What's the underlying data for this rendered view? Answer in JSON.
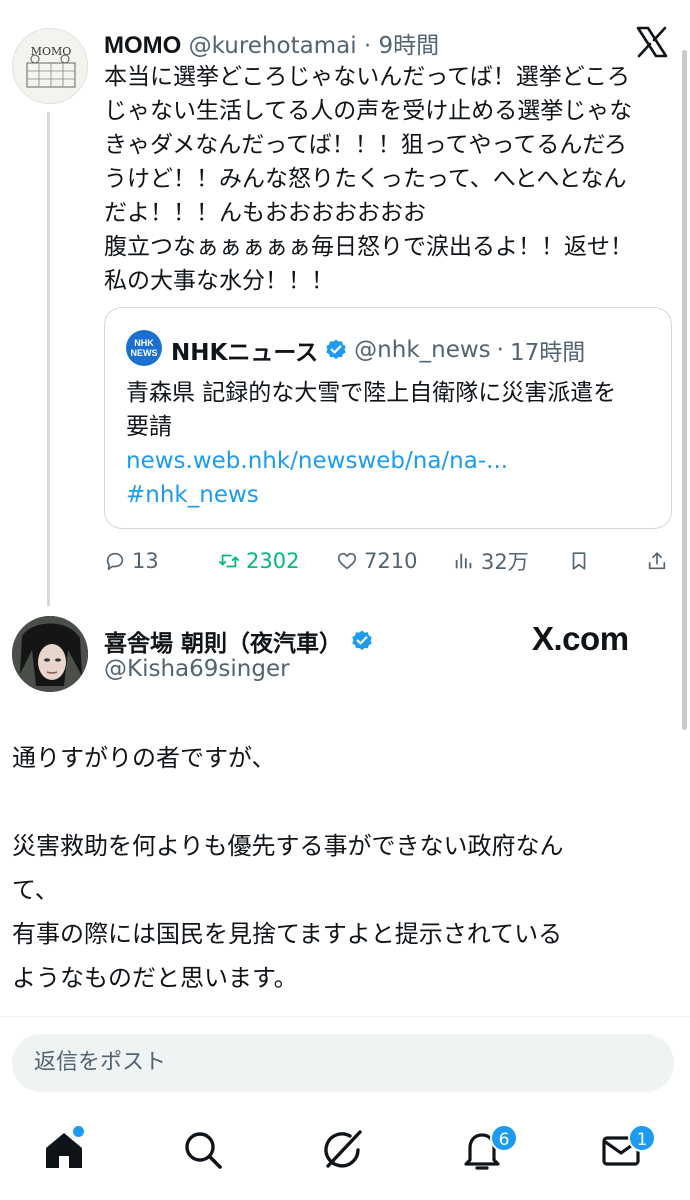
{
  "parent_tweet": {
    "author_name": "MOMO",
    "author_handle": "@kurehotamai",
    "separator": "·",
    "time": "9時間",
    "avatar_text": "MOMO",
    "text_lines": [
      "本当に選挙どころじゃないんだってば！選挙どころ",
      "じゃない生活してる人の声を受け止める選挙じゃな",
      "きゃダメなんだってば！！！狙ってやってるんだろ",
      "うけど！！みんな怒りたくったって、へとへとなん",
      "だよ！！！んもおおおおおおお",
      "腹立つなぁぁぁぁぁ毎日怒りで涙出るよ！！返せ！",
      "私の大事な水分！！！"
    ],
    "quote": {
      "logo_text": "NHK NEWS",
      "name": "NHKニュース",
      "handle": "@nhk_news",
      "separator": "·",
      "time": "17時間",
      "text_lines": [
        "青森県 記録的な大雪で陸上自衛隊に災害派遣を",
        "要請"
      ],
      "link": "news.web.nhk/newsweb/na/na-...",
      "hashtag": "#nhk_news"
    },
    "actions": {
      "replies": "13",
      "retweets": "2302",
      "likes": "7210",
      "views": "32万"
    }
  },
  "reply": {
    "author_name": "喜舎場 朝則（夜汽車）",
    "author_handle": "@Kisha69singer",
    "watermark": "X.com",
    "paragraphs": [
      "通りすがりの者ですが、",
      "",
      "災害救助を何よりも優先する事ができない政府なん",
      "て、",
      "有事の際には国民を見捨てますよと提示されている",
      "ようなものだと思います。"
    ]
  },
  "compose": {
    "placeholder": "返信をポスト"
  },
  "tabbar": {
    "notifications_badge": "6",
    "messages_badge": "1"
  },
  "colors": {
    "accent": "#1d9bf0",
    "retweet_green": "#00ba7c",
    "secondary_text": "#536471"
  }
}
